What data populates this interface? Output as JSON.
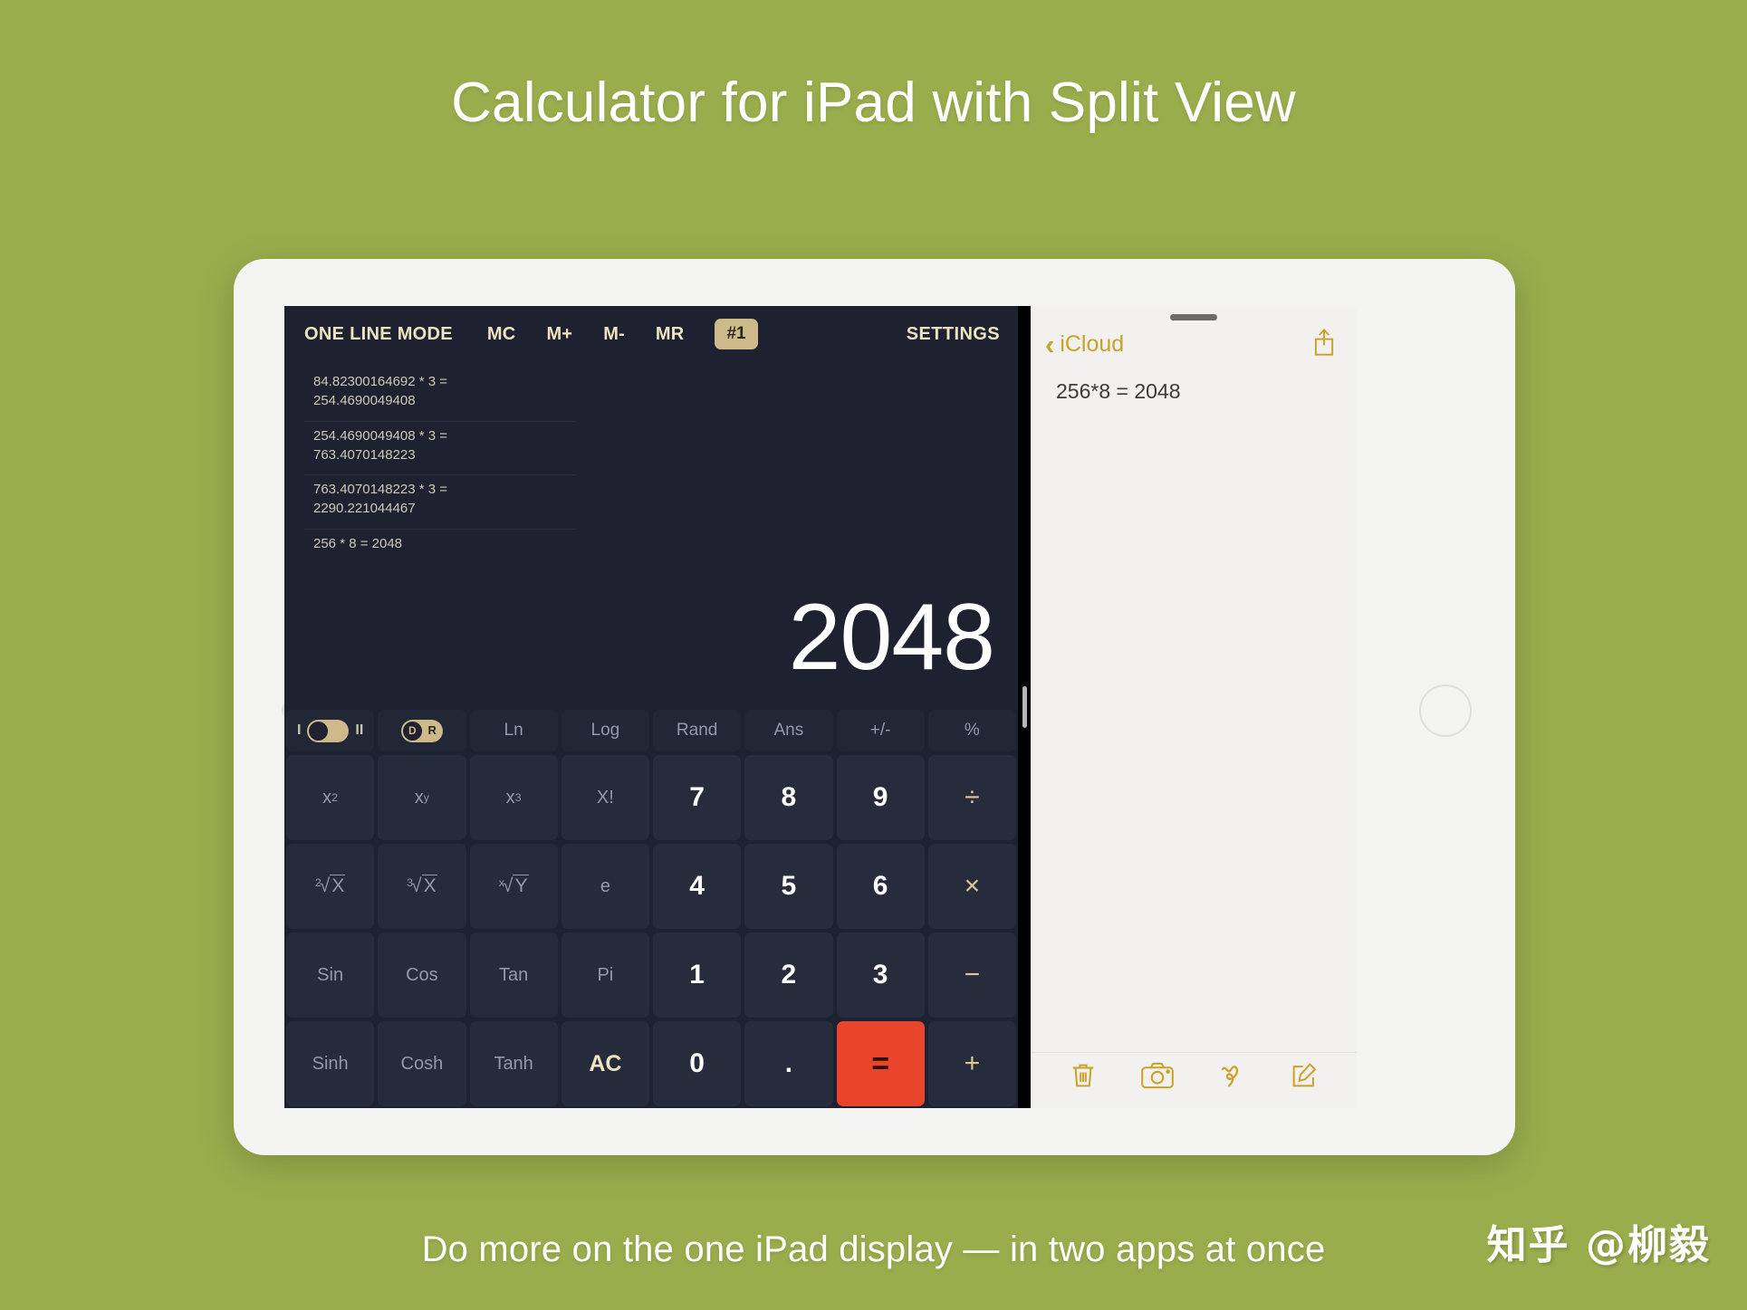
{
  "page": {
    "headline": "Calculator for iPad with Split View",
    "caption": "Do more on the one iPad display — in two apps at once",
    "watermark": "知乎 @柳毅",
    "background_color": "#9aad4d"
  },
  "calculator": {
    "mode_label": "ONE LINE MODE",
    "memory_buttons": [
      "MC",
      "M+",
      "M-",
      "MR"
    ],
    "memory_badge": "#1",
    "settings_label": "SETTINGS",
    "display_value": "2048",
    "accent_gold": "#cdb98a",
    "equals_color": "#e8452c",
    "history": [
      "84.82300164692 * 3 =\n254.4690049408",
      "254.4690049408 * 3 =\n763.4070148223",
      "763.4070148223 * 3 =\n2290.221044467",
      "256 * 8 = 2048"
    ],
    "toggles": {
      "mode_switch": {
        "left_label": "I",
        "right_label": "II",
        "position": "left"
      },
      "angle_switch": {
        "knob_label": "D",
        "side_label": "R",
        "position": "left"
      }
    },
    "function_row": [
      "Ln",
      "Log",
      "Rand",
      "Ans",
      "+/-",
      "%"
    ],
    "rows": [
      [
        {
          "label": "x",
          "sup": "2",
          "type": "fn"
        },
        {
          "label": "x",
          "sup": "y",
          "type": "fn"
        },
        {
          "label": "x",
          "sup": "3",
          "type": "fn"
        },
        {
          "label": "X!",
          "type": "fn"
        },
        {
          "label": "7",
          "type": "num"
        },
        {
          "label": "8",
          "type": "num"
        },
        {
          "label": "9",
          "type": "num"
        },
        {
          "label": "÷",
          "type": "op"
        }
      ],
      [
        {
          "label": "X",
          "root": "2",
          "type": "fn"
        },
        {
          "label": "X",
          "root": "3",
          "type": "fn"
        },
        {
          "label": "Y",
          "root": "x",
          "type": "fn"
        },
        {
          "label": "e",
          "type": "fn"
        },
        {
          "label": "4",
          "type": "num"
        },
        {
          "label": "5",
          "type": "num"
        },
        {
          "label": "6",
          "type": "num"
        },
        {
          "label": "×",
          "type": "op"
        }
      ],
      [
        {
          "label": "Sin",
          "type": "fn"
        },
        {
          "label": "Cos",
          "type": "fn"
        },
        {
          "label": "Tan",
          "type": "fn"
        },
        {
          "label": "Pi",
          "type": "fn"
        },
        {
          "label": "1",
          "type": "num"
        },
        {
          "label": "2",
          "type": "num"
        },
        {
          "label": "3",
          "type": "num"
        },
        {
          "label": "−",
          "type": "op"
        }
      ],
      [
        {
          "label": "Sinh",
          "type": "fn"
        },
        {
          "label": "Cosh",
          "type": "fn"
        },
        {
          "label": "Tanh",
          "type": "fn"
        },
        {
          "label": "AC",
          "type": "ac"
        },
        {
          "label": "0",
          "type": "num"
        },
        {
          "label": ".",
          "type": "num"
        },
        {
          "label": "=",
          "type": "eq"
        },
        {
          "label": "+",
          "type": "op"
        }
      ]
    ]
  },
  "notes": {
    "back_label": "iCloud",
    "note_text": "256*8 = 2048",
    "accent_gold": "#c9a227",
    "toolbar_icons": [
      "trash-icon",
      "camera-icon",
      "markup-icon",
      "compose-icon"
    ]
  }
}
